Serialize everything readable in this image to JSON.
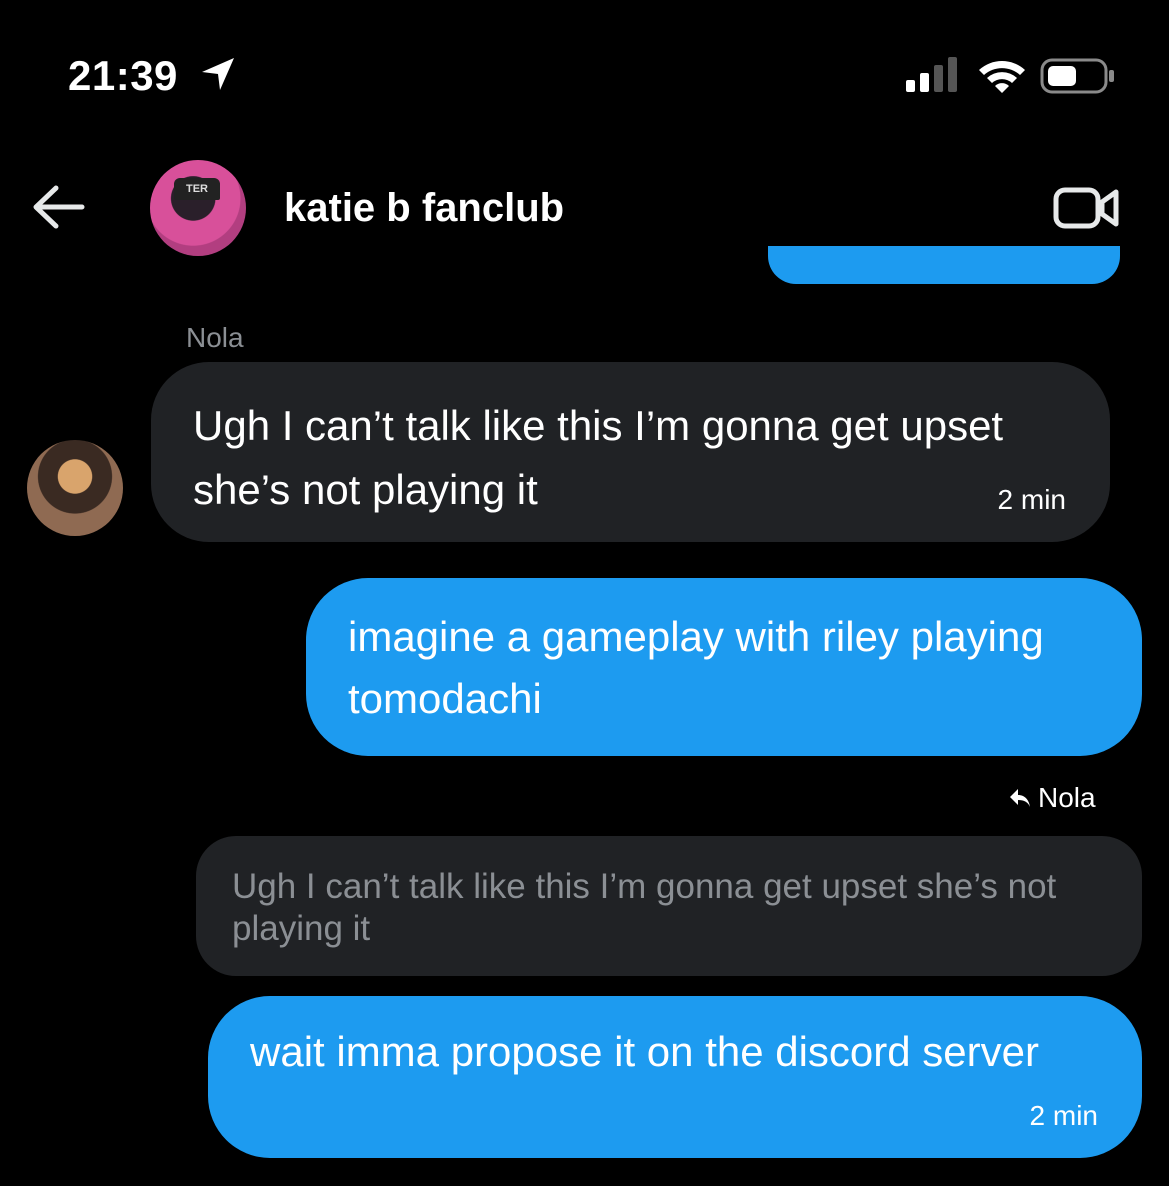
{
  "status_bar": {
    "time": "21:39",
    "location_icon": "location-arrow-icon",
    "signal_icon": "cellular-signal-icon",
    "wifi_icon": "wifi-icon",
    "battery_icon": "battery-icon"
  },
  "header": {
    "back_icon": "arrow-left-icon",
    "group_avatar_caption": "TER",
    "title": "katie b fanclub",
    "video_icon": "video-camera-icon"
  },
  "messages": [
    {
      "sender": "Nola",
      "text": "Ugh I can’t talk like this I’m gonna get upset she’s not playing it",
      "time": "2 min",
      "direction": "incoming"
    },
    {
      "text": "imagine a gameplay with riley playing tomodachi",
      "direction": "outgoing"
    },
    {
      "reply_to_label": "Nola",
      "quoted_text": "Ugh I can’t talk like this I’m gonna get upset she’s not playing it",
      "text": "wait imma propose it on the discord server",
      "time": "2 min",
      "direction": "outgoing"
    }
  ],
  "colors": {
    "background": "#000000",
    "outgoing_bubble": "#1d9bf0",
    "incoming_bubble": "#202225",
    "muted_text": "#8b8f94"
  }
}
